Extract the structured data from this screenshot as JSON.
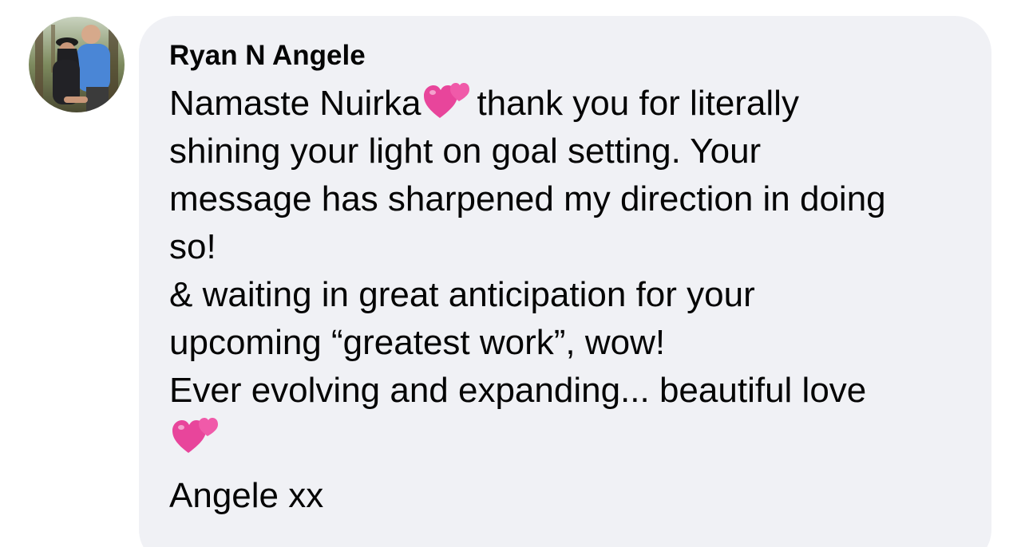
{
  "comment": {
    "author_name": "Ryan N Angele",
    "avatar_icon": "profile-photo-couple",
    "emoji_icon": "two-hearts-emoji",
    "lines": [
      "Namaste Nuirka",
      "thank you for literally",
      "shining your light on goal setting. Your",
      "message has sharpened my direction in doing",
      "so!",
      "& waiting in great anticipation for your",
      "upcoming “greatest work”, wow!",
      "Ever evolving and expanding... beautiful love",
      "Angele xx"
    ]
  },
  "colors": {
    "bubble_background": "#f0f1f5",
    "text": "#050505",
    "heart": "#e8459b"
  }
}
